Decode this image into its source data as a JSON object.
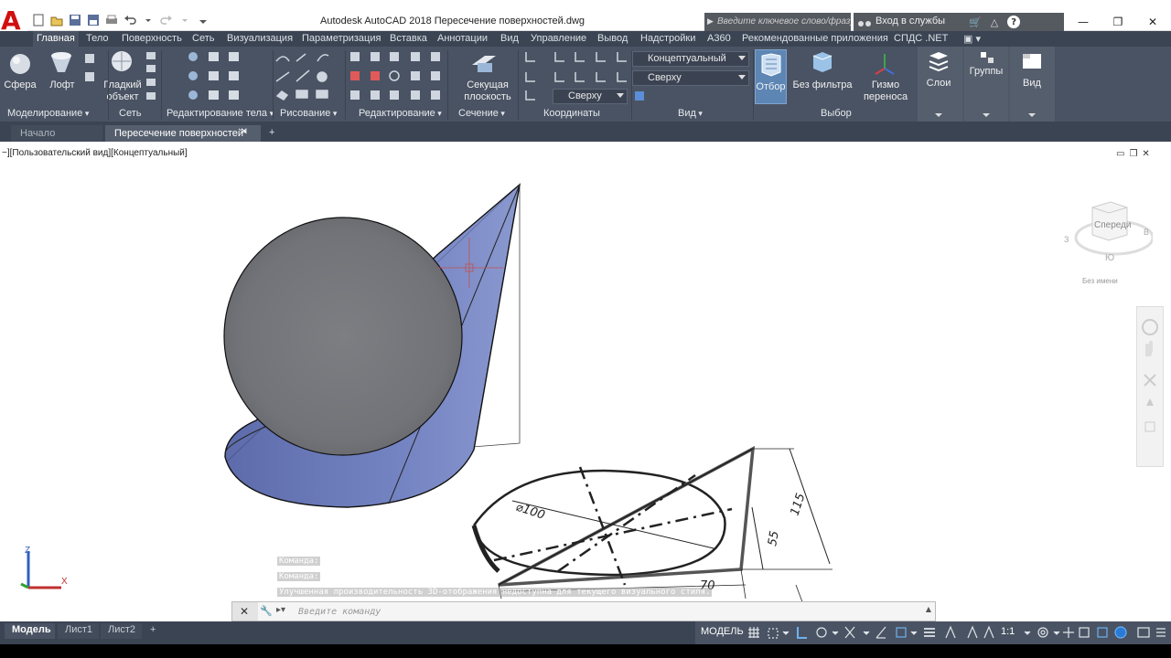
{
  "app": {
    "logo_letter": "A",
    "title": "Autodesk AutoCAD 2018    Пересечение поверхностей.dwg",
    "search_placeholder": "Введите ключевое слово/фразу",
    "signin": "Вход в службы"
  },
  "ribbon_tabs": [
    "Главная",
    "Тело",
    "Поверхность",
    "Сеть",
    "Визуализация",
    "Параметризация",
    "Вставка",
    "Аннотации",
    "Вид",
    "Управление",
    "Вывод",
    "Надстройки",
    "A360",
    "Рекомендованные приложения",
    "СПДС .NET"
  ],
  "active_tab_index": 0,
  "ribbon": {
    "buttons": {
      "sphere": "Сфера",
      "loft": "Лофт",
      "smooth_object": "Гладкий объект",
      "section_plane": "Секущая плоскость",
      "otbor": "Отбор",
      "no_filter": "Без фильтра",
      "gizmo": "Гизмо переноса",
      "layers": "Слои",
      "groups": "Группы",
      "view": "Вид"
    },
    "dropdowns": {
      "visual_style": "Концептуальный",
      "view_top": "Сверху",
      "ucs_top": "Сверху"
    },
    "panels": [
      "Моделирование",
      "Сеть",
      "Редактирование тела",
      "Рисование",
      "Редактирование",
      "Сечение",
      "Координаты",
      "Вид",
      "Выбор"
    ]
  },
  "file_tabs": {
    "start": "Начало",
    "drawing": "Пересечение поверхностей*"
  },
  "viewport": {
    "label": "−][Пользовательский вид][Концептуальный]",
    "viewcube_face": "Спереди",
    "viewcube_compass": [
      "В",
      "Ю",
      "З"
    ],
    "viewcube_label": "Без имени",
    "drawing_dims": {
      "diameter": "⌀100",
      "height_total": "115",
      "height_mid": "55",
      "base": "70"
    },
    "ucs": {
      "x": "X",
      "z": "Z"
    }
  },
  "command": {
    "history": [
      "Команда:",
      "Команда:",
      "Улучшенная производительность 3D-отображения недоступна для текущего визуального стиля."
    ],
    "placeholder": "Введите команду"
  },
  "statusbar": {
    "layout_tabs": [
      "Модель",
      "Лист1",
      "Лист2"
    ],
    "mode": "МОДЕЛЬ",
    "scale": "1:1"
  },
  "colors": {
    "ribbon_bg": "#4a5363",
    "tab_bar_bg": "#3b4453",
    "cone_fill": "#6b7ab8",
    "sphere_fill": "#76777c",
    "accent_selected": "#5d86b5"
  }
}
